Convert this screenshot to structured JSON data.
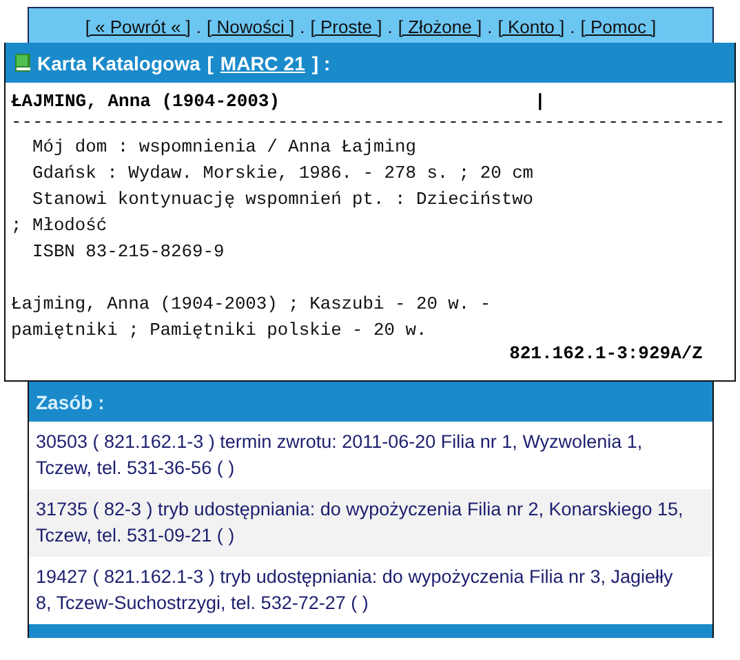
{
  "nav": {
    "items": [
      "[ « Powrót « ]",
      "[ Nowości ]",
      "[ Proste ]",
      "[ Złożone ]",
      "[ Konto ]",
      "[ Pomoc ]"
    ],
    "separator": "."
  },
  "card": {
    "title": "Karta Katalogowa",
    "bracket_open": "[",
    "link": "MARC 21",
    "bracket_close": "] :",
    "heading": "ŁAJMING, Anna (1904-2003)",
    "cursor": "|",
    "rule": "-------------------------------------------------------------------",
    "description": [
      "  Mój dom : wspomnienia / Anna Łajming",
      "  Gdańsk : Wydaw. Morskie, 1986. - 278 s. ; 20 cm",
      "  Stanowi kontynuację wspomnień pt. : Dzieciństwo",
      "; Młodość",
      "  ISBN 83-215-8269-9"
    ],
    "subjects": [
      "Łajming, Anna (1904-2003) ; Kaszubi - 20 w. -",
      "pamiętniki ; Pamiętniki polskie - 20 w."
    ],
    "call_number": "821.162.1-3:929A/Z"
  },
  "holdings": {
    "title": "Zasób :",
    "rows": [
      {
        "text": "30503 ( 821.162.1-3 ) termin zwrotu: 2011-06-20 Filia nr 1, Wyzwolenia 1, Tczew, tel. 531-36-56 ( )"
      },
      {
        "text": "31735 ( 82-3 ) tryb udostępniania: do wypożyczenia Filia nr 2, Konarskiego 15, Tczew, tel. 531-09-21 ( )"
      },
      {
        "text": "19427 ( 821.162.1-3 ) tryb udostępniania: do wypożyczenia Filia nr 3, Jagiełły 8, Tczew-Suchostrzygi, tel. 532-72-27 ( )"
      }
    ]
  }
}
